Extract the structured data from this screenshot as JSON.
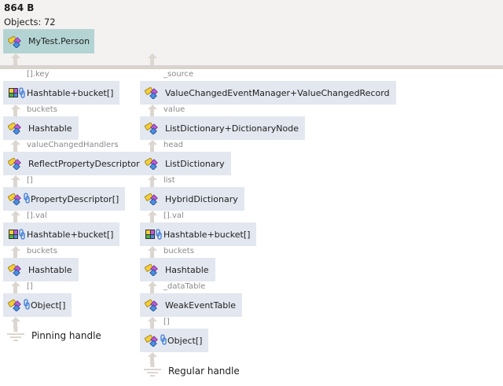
{
  "header": {
    "size": "864 B",
    "objects": "Objects: 72",
    "root": "MyTest.Person"
  },
  "left": {
    "edges": [
      "[].key",
      "buckets",
      "valueChangedHandlers",
      "[]",
      "[].val",
      "buckets",
      "[]"
    ],
    "nodes": [
      {
        "label": "Hashtable+bucket[]",
        "icon": "array"
      },
      {
        "label": "Hashtable",
        "icon": "class"
      },
      {
        "label": "ReflectPropertyDescriptor",
        "icon": "class"
      },
      {
        "label": "PropertyDescriptor[]",
        "icon": "class-array"
      },
      {
        "label": "Hashtable+bucket[]",
        "icon": "array"
      },
      {
        "label": "Hashtable",
        "icon": "class"
      },
      {
        "label": "Object[]",
        "icon": "class-array"
      }
    ],
    "handle": "Pinning handle"
  },
  "right": {
    "edges": [
      "_source",
      "value",
      "head",
      "list",
      "[].val",
      "buckets",
      "_dataTable",
      "[]"
    ],
    "nodes": [
      {
        "label": "ValueChangedEventManager+ValueChangedRecord",
        "icon": "class"
      },
      {
        "label": "ListDictionary+DictionaryNode",
        "icon": "class"
      },
      {
        "label": "ListDictionary",
        "icon": "class"
      },
      {
        "label": "HybridDictionary",
        "icon": "class"
      },
      {
        "label": "Hashtable+bucket[]",
        "icon": "array"
      },
      {
        "label": "Hashtable",
        "icon": "class"
      },
      {
        "label": "WeakEventTable",
        "icon": "class"
      },
      {
        "label": "Object[]",
        "icon": "class-array"
      }
    ],
    "handle": "Regular handle"
  }
}
